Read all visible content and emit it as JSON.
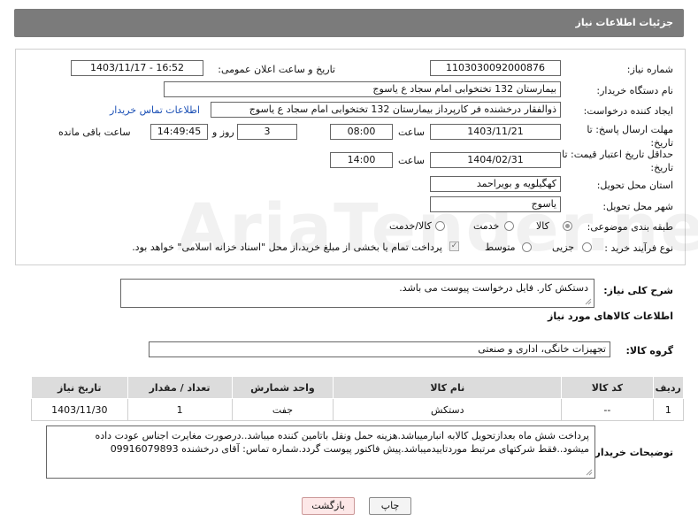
{
  "header": {
    "title": "جزئیات اطلاعات نیاز"
  },
  "form": {
    "need_number_label": "شماره نیاز:",
    "need_number": "1103030092000876",
    "announce_label": "تاریخ و ساعت اعلان عمومی:",
    "announce_value": "1403/11/17 - 16:52",
    "buyer_label": "نام دستگاه خریدار:",
    "buyer_value": "بیمارستان 132 تختخوابی امام سجاد  ع  یاسوج",
    "creator_label": "ایجاد کننده درخواست:",
    "creator_value": "ذوالفقار درخشنده فر کارپرداز بیمارستان 132 تختخوابی امام سجاد  ع  یاسوج",
    "contact_link": "اطلاعات تماس خریدار",
    "deadline_label_1": "مهلت ارسال پاسخ: تا",
    "deadline_label_2": "تاریخ:",
    "deadline_date": "1403/11/21",
    "time_label": "ساعت",
    "deadline_time": "08:00",
    "days_value": "3",
    "days_label": "روز و",
    "remaining_time": "14:49:45",
    "remaining_label": "ساعت باقی مانده",
    "validity_label_1": "حداقل تاریخ اعتبار قیمت: تا",
    "validity_label_2": "تاریخ:",
    "validity_date": "1404/02/31",
    "validity_time_label": "ساعت",
    "validity_time": "14:00",
    "province_label": "استان محل تحویل:",
    "province_value": "کهگیلویه و بویراحمد",
    "city_label": "شهر محل تحویل:",
    "city_value": "یاسوج",
    "category_label": "طبقه بندی موضوعی:",
    "category_options": [
      "کالا",
      "خدمت",
      "کالا/خدمت"
    ],
    "category_selected": "کالا",
    "process_label": "نوع فرآیند خرید :",
    "process_options": [
      "جزیی",
      "متوسط"
    ],
    "payment_note": "پرداخت تمام یا بخشی از مبلغ خرید،از محل \"اسناد خزانه اسلامی\" خواهد بود."
  },
  "description": {
    "label": "شرح کلی نیاز:",
    "value": "دستکش کار.   فایل درخواست پیوست می باشد."
  },
  "goods": {
    "section_title": "اطلاعات کالاهای مورد نیاز",
    "group_label": "گروه کالا:",
    "group_value": "تجهیزات خانگی، اداری و صنعتی",
    "columns": [
      "ردیف",
      "کد کالا",
      "نام کالا",
      "واحد شمارش",
      "تعداد / مقدار",
      "تاریخ نیاز"
    ],
    "rows": [
      [
        "1",
        "--",
        "دستکش",
        "جفت",
        "1",
        "1403/11/30"
      ]
    ]
  },
  "buyer_notes": {
    "label": "توضیحات خریدار:",
    "value": "پرداخت شش ماه بعدازتحویل کالابه انبارمیباشد.هزینه حمل ونقل باتامین کننده میباشد..درصورت مغایرت اجناس عودت داده میشود..فقط شرکتهای مرتبط موردتاییدمیباشد.پیش فاکتور پیوست گردد.شماره تماس: آقای درخشنده 09916079893"
  },
  "buttons": {
    "print": "چاپ",
    "back": "بازگشت"
  },
  "watermark": "AriaTender.net"
}
